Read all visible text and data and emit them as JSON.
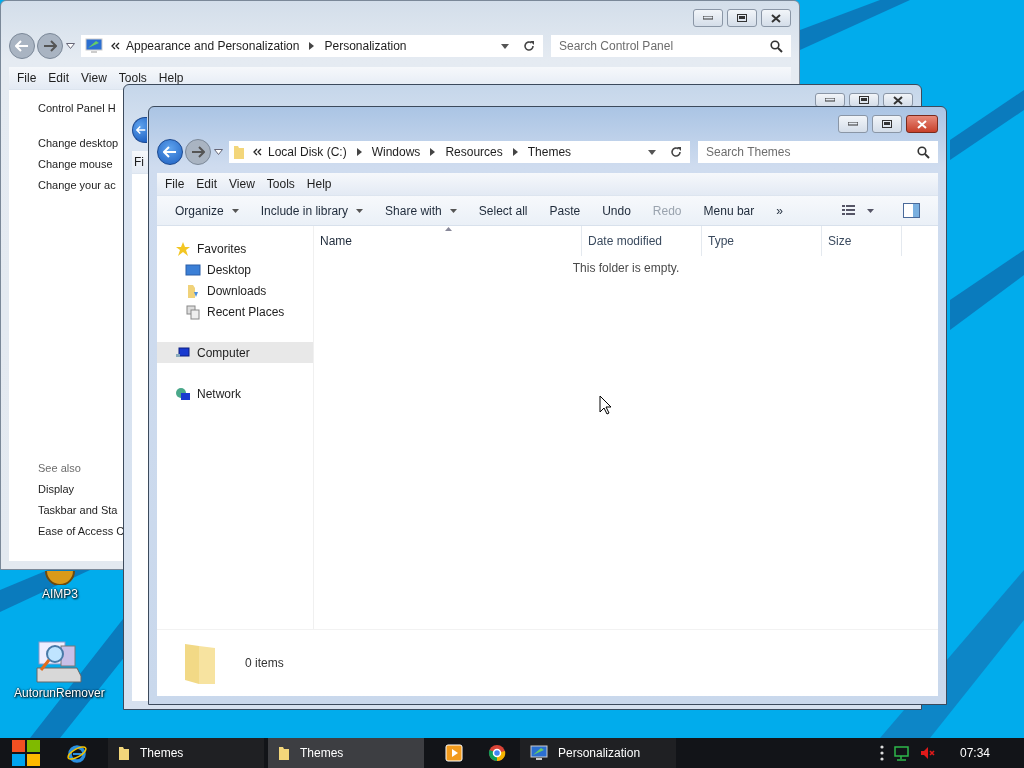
{
  "desktop": {
    "icons": [
      {
        "label": "AIMP3",
        "kind": "player"
      },
      {
        "label": "AutorunRemover",
        "kind": "scanner"
      }
    ]
  },
  "control_panel_window": {
    "navigation": {
      "back_enabled": false,
      "forward_enabled": false
    },
    "address": {
      "crumbs": [
        "Appearance and Personalization",
        "Personalization"
      ]
    },
    "search": {
      "placeholder": "Search Control Panel"
    },
    "menu": [
      "File",
      "Edit",
      "View",
      "Tools",
      "Help"
    ],
    "tasks": [
      "Control Panel H",
      "Change desktop",
      "Change mouse",
      "Change your ac"
    ],
    "see_also": {
      "heading": "See also",
      "links": [
        "Display",
        "Taskbar and Sta",
        "Ease of Access C"
      ]
    }
  },
  "background_window": {
    "navigation": {
      "back_enabled": true
    },
    "menu": [
      "Fi"
    ]
  },
  "explorer_window": {
    "navigation": {
      "back_enabled": true,
      "forward_enabled": false
    },
    "address": {
      "crumbs": [
        "Local Disk (C:)",
        "Windows",
        "Resources",
        "Themes"
      ]
    },
    "search": {
      "placeholder": "Search Themes"
    },
    "menu": [
      "File",
      "Edit",
      "View",
      "Tools",
      "Help"
    ],
    "toolbar": [
      {
        "label": "Organize",
        "dropdown": true,
        "disabled": false
      },
      {
        "label": "Include in library",
        "dropdown": true,
        "disabled": false
      },
      {
        "label": "Share with",
        "dropdown": true,
        "disabled": false
      },
      {
        "label": "Select all",
        "dropdown": false,
        "disabled": false
      },
      {
        "label": "Paste",
        "dropdown": false,
        "disabled": false
      },
      {
        "label": "Undo",
        "dropdown": false,
        "disabled": false
      },
      {
        "label": "Redo",
        "dropdown": false,
        "disabled": true
      },
      {
        "label": "Menu bar",
        "dropdown": false,
        "disabled": false
      },
      {
        "label": "»",
        "dropdown": false,
        "disabled": false
      }
    ],
    "navigation_pane": [
      {
        "label": "Favorites",
        "kind": "star",
        "selected": false,
        "children": [
          {
            "label": "Desktop",
            "kind": "desktop",
            "selected": false
          },
          {
            "label": "Downloads",
            "kind": "downloads",
            "selected": false
          },
          {
            "label": "Recent Places",
            "kind": "recent",
            "selected": false
          }
        ]
      },
      {
        "label": "Computer",
        "kind": "computer",
        "selected": true
      },
      {
        "label": "Network",
        "kind": "network",
        "selected": false
      }
    ],
    "columns": [
      {
        "label": "Name",
        "sorted": true
      },
      {
        "label": "Date modified",
        "sorted": false
      },
      {
        "label": "Type",
        "sorted": false
      },
      {
        "label": "Size",
        "sorted": false
      }
    ],
    "empty_message": "This folder is empty.",
    "item_count": "0 items"
  },
  "taskbar": {
    "items": [
      {
        "kind": "start",
        "selected": false
      },
      {
        "kind": "ie",
        "selected": false
      },
      {
        "kind": "folder",
        "label": "Themes",
        "selected": false
      },
      {
        "kind": "folder",
        "label": "Themes",
        "selected": true
      },
      {
        "kind": "media",
        "selected": false
      },
      {
        "kind": "chrome",
        "selected": false
      },
      {
        "kind": "control",
        "label": "Personalization",
        "selected": false
      }
    ],
    "tray": {
      "muted": true,
      "clock": "07:34"
    }
  }
}
